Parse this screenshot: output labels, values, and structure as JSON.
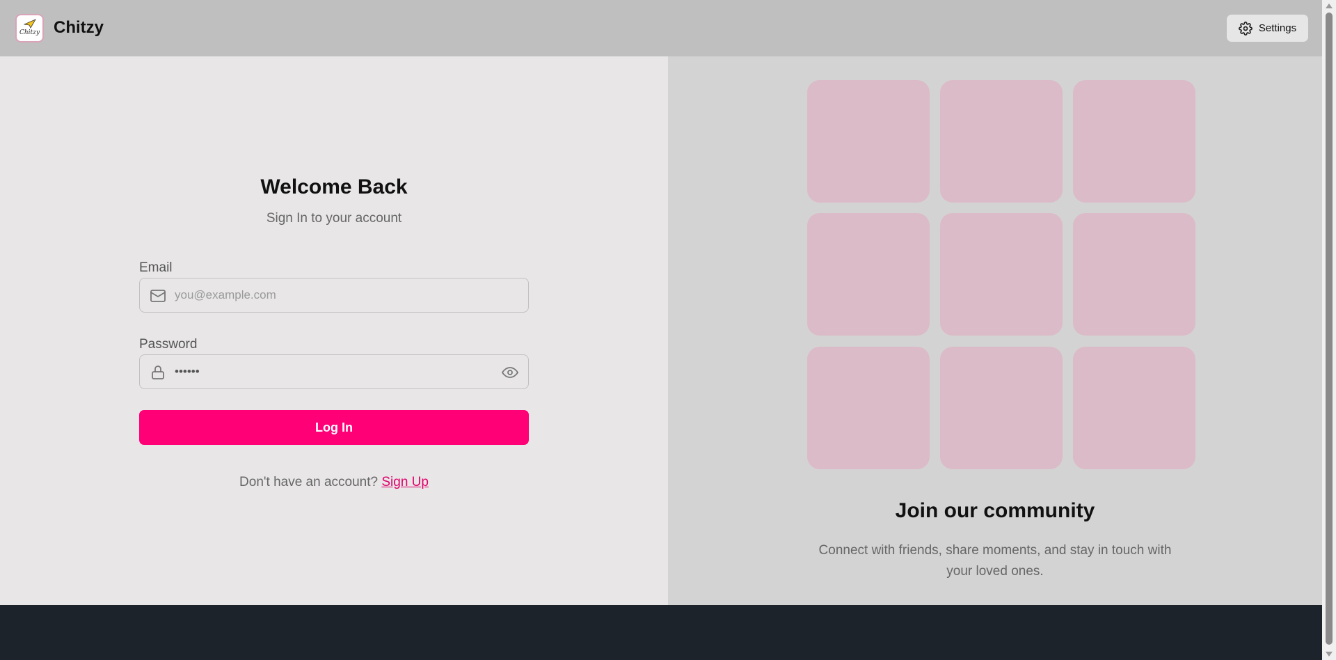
{
  "header": {
    "logo_text": "Chitzy",
    "app_name": "Chitzy",
    "settings_label": "Settings"
  },
  "login": {
    "title": "Welcome Back",
    "subtitle": "Sign In to your account",
    "email_label": "Email",
    "email_placeholder": "you@example.com",
    "password_label": "Password",
    "password_value": "••••••",
    "login_button": "Log In",
    "signup_prompt": "Don't have an account?",
    "signup_link": "Sign Up"
  },
  "community": {
    "title": "Join our community",
    "description": "Connect with friends, share moments, and stay in touch with your loved ones."
  },
  "colors": {
    "accent": "#ff0077",
    "tile": "#dbbbc7",
    "header_bg": "#bfbfbf"
  },
  "icons": [
    "gear-icon",
    "mail-icon",
    "lock-icon",
    "eye-icon",
    "paper-plane-icon"
  ]
}
